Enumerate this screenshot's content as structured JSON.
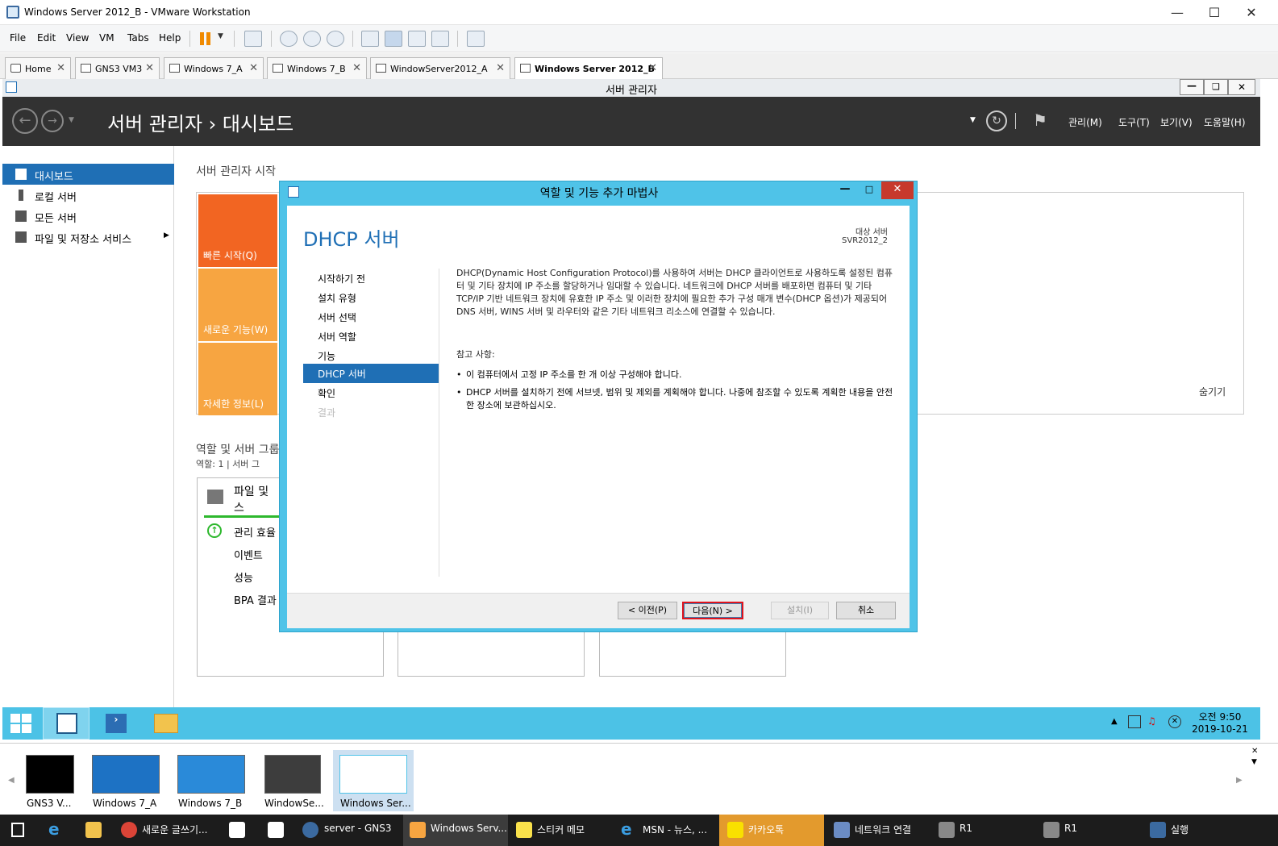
{
  "vmware": {
    "title": "Windows Server 2012_B - VMware Workstation",
    "menu": [
      "File",
      "Edit",
      "View",
      "VM",
      "Tabs",
      "Help"
    ],
    "tabs": [
      "Home",
      "GNS3 VM3",
      "Windows 7_A",
      "Windows 7_B",
      "WindowServer2012_A",
      "Windows Server 2012_B"
    ],
    "active_tab": "Windows Server 2012_B"
  },
  "server_manager": {
    "window_title": "서버 관리자",
    "breadcrumb": "서버 관리자 › 대시보드",
    "header_menu": [
      "관리(M)",
      "도구(T)",
      "보기(V)",
      "도움말(H)"
    ],
    "nav": [
      "대시보드",
      "로컬 서버",
      "모든 서버",
      "파일 및 저장소 서비스"
    ],
    "active_nav": "대시보드",
    "welcome_title": "서버 관리자 시작",
    "tiles": [
      "빠른 시작(Q)",
      "새로운 기능(W)",
      "자세한 정보(L)"
    ],
    "tile_colors": [
      "#f26522",
      "#f7a541",
      "#f7a541"
    ],
    "hide_link": "숨기기",
    "roles_title": "역할 및 서버 그룹",
    "roles_sub": "역할: 1  |  서버 그",
    "role_card": {
      "title": "파일 및",
      "title2": "스",
      "rows": [
        "관리 효율",
        "이벤트",
        "성능",
        "BPA 결과"
      ]
    }
  },
  "wizard": {
    "title": "역할 및 기능 추가 마법사",
    "page_title": "DHCP 서버",
    "target_label": "대상 서버",
    "target_server": "SVR2012_2",
    "steps": [
      "시작하기 전",
      "설치 유형",
      "서버 선택",
      "서버 역할",
      "기능",
      "DHCP 서버",
      "확인",
      "결과"
    ],
    "active_step": "DHCP 서버",
    "description": "DHCP(Dynamic Host Configuration Protocol)를 사용하여 서버는 DHCP 클라이언트로 사용하도록 설정된 컴퓨터 및 기타 장치에 IP 주소를 할당하거나 임대할 수 있습니다. 네트워크에 DHCP 서버를 배포하면 컴퓨터 및 기타 TCP/IP 기반 네트워크 장치에 유효한 IP 주소 및 이러한 장치에 필요한 추가 구성 매개 변수(DHCP 옵션)가 제공되어 DNS 서버, WINS 서버 및 라우터와 같은 기타 네트워크 리소스에 연결할 수 있습니다.",
    "notes_title": "참고 사항:",
    "notes": [
      "이 컴퓨터에서 고정 IP 주소를 한 개 이상 구성해야 합니다.",
      "DHCP 서버를 설치하기 전에 서브넷, 범위 및 제외를 계획해야 합니다. 나중에 참조할 수 있도록 계획한 내용을 안전한 장소에 보관하십시오."
    ],
    "buttons": {
      "prev": "< 이전(P)",
      "next": "다음(N) >",
      "install": "설치(I)",
      "cancel": "취소"
    }
  },
  "vm_taskbar": {
    "time": "오전 9:50",
    "date": "2019-10-21"
  },
  "thumbnails": [
    "GNS3 V...",
    "Windows 7_A",
    "Windows 7_B",
    "WindowSe...",
    "Windows Ser..."
  ],
  "host_taskbar": [
    "새로운 글쓰기...",
    "server - GNS3",
    "Windows Serv...",
    "스티커 메모",
    "MSN - 뉴스, ...",
    "카카오톡",
    "네트워크 연결",
    "R1",
    "R1",
    "실행"
  ]
}
